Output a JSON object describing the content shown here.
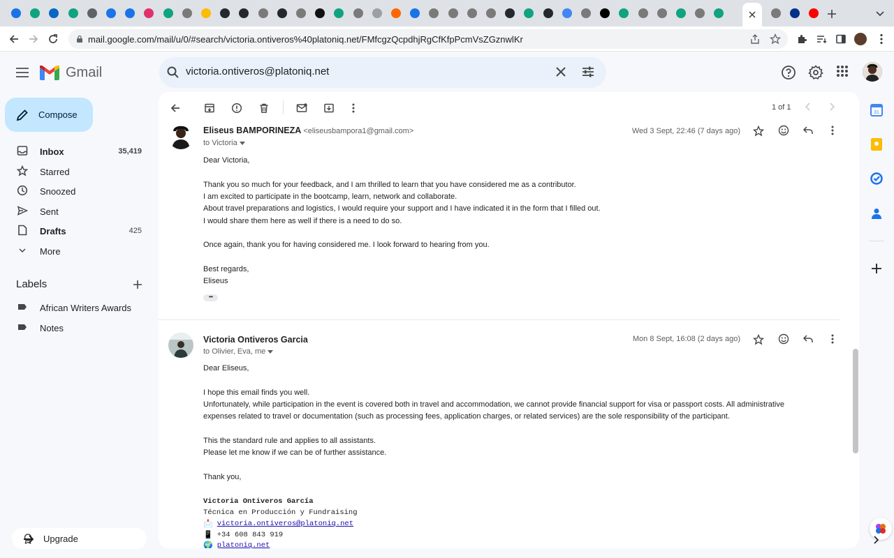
{
  "browser": {
    "url": "mail.google.com/mail/u/0/#search/victoria.ontiveros%40platoniq.net/FMfcgzQcpdhjRgCfKfpPcmVsZGznwlKr",
    "tab_favicons": [
      "chrome-icon",
      "openai-icon",
      "linkedin-icon",
      "openai-icon",
      "account-icon",
      "chrome-icon",
      "chrome-icon",
      "instagram-icon",
      "openai-icon",
      "app-icon",
      "yellow-circle-icon",
      "github-icon",
      "github-icon",
      "app-icon",
      "github-icon",
      "app-icon",
      "notion-icon",
      "openai-icon",
      "app-icon",
      "page-icon",
      "ycombinator-icon",
      "calendar-icon",
      "app-icon",
      "app-icon",
      "app-icon",
      "app-icon",
      "github-icon",
      "openai-icon",
      "github-icon",
      "google-icon",
      "app-icon",
      "x-icon",
      "openai-icon",
      "app-icon",
      "app-icon",
      "openai-icon",
      "app-icon",
      "openai-icon",
      "x-icon",
      "x-icon",
      "app-icon",
      "paypal-icon",
      "youtube-icon"
    ]
  },
  "header": {
    "product": "Gmail",
    "search_query": "victoria.ontiveros@platoniq.net"
  },
  "sidebar": {
    "compose_label": "Compose",
    "items": [
      {
        "label": "Inbox",
        "count": "35,419",
        "icon": "inbox-icon"
      },
      {
        "label": "Starred",
        "count": "",
        "icon": "star-icon"
      },
      {
        "label": "Snoozed",
        "count": "",
        "icon": "clock-icon"
      },
      {
        "label": "Sent",
        "count": "",
        "icon": "send-icon"
      },
      {
        "label": "Drafts",
        "count": "425",
        "icon": "draft-icon"
      },
      {
        "label": "More",
        "count": "",
        "icon": "chevron-down-icon"
      }
    ],
    "labels_heading": "Labels",
    "labels": [
      "African Writers Awards",
      "Notes"
    ],
    "upgrade_label": "Upgrade"
  },
  "toolbar": {
    "pager": "1 of 1"
  },
  "messages": [
    {
      "sender_name": "Eliseus BAMPORINEZA",
      "sender_email": "<eliseusbampora1@gmail.com>",
      "recipients": "to Victoria",
      "date": "Wed 3 Sept, 22:46 (7 days ago)",
      "body": [
        "Dear Victoria,",
        "Thank you so much for your feedback, and I am thrilled to learn that you have considered me as a contributor.",
        "I am excited to participate in the bootcamp, learn, network and collaborate.",
        "About travel preparations and logistics, I would require your support and I have indicated it in the form that I filled out.",
        "I would share them here as well if there is a need to do so.",
        "Once again, thank you for having considered me. I look forward to hearing from you.",
        "Best regards,",
        "Eliseus"
      ],
      "trimmed_indicator": "•••"
    },
    {
      "sender_name": "Victoria Ontiveros Garcia",
      "recipients": "to Olivier, Eva, me",
      "date": "Mon 8 Sept, 16:08 (2 days ago)",
      "body": [
        "Dear Eliseus,",
        "I hope this email finds you well.",
        "Unfortunately, while participation in the event is covered both in travel and accommodation, we cannot provide financial support for visa or passport costs. All administrative",
        "expenses related to travel or documentation (such as processing fees, application charges, or related services) are the sole responsibility of the participant.",
        "This the standard rule and applies to all assistants.",
        "Please let me know if we can be of further assistance.",
        "Thank you,"
      ],
      "signature": {
        "name": "Victoria Ontiveros García",
        "role": "Técnica en Producción y Fundraising",
        "email": "victoria.ontiveros@platoniq.net",
        "phone": "+34 608 843 919",
        "website": "platoniq.net"
      }
    }
  ],
  "colors": {
    "compose_bg": "#c2e7ff",
    "search_bg": "#eaf1fb",
    "page_bg": "#f6f8fc",
    "link": "#1a0dab"
  }
}
